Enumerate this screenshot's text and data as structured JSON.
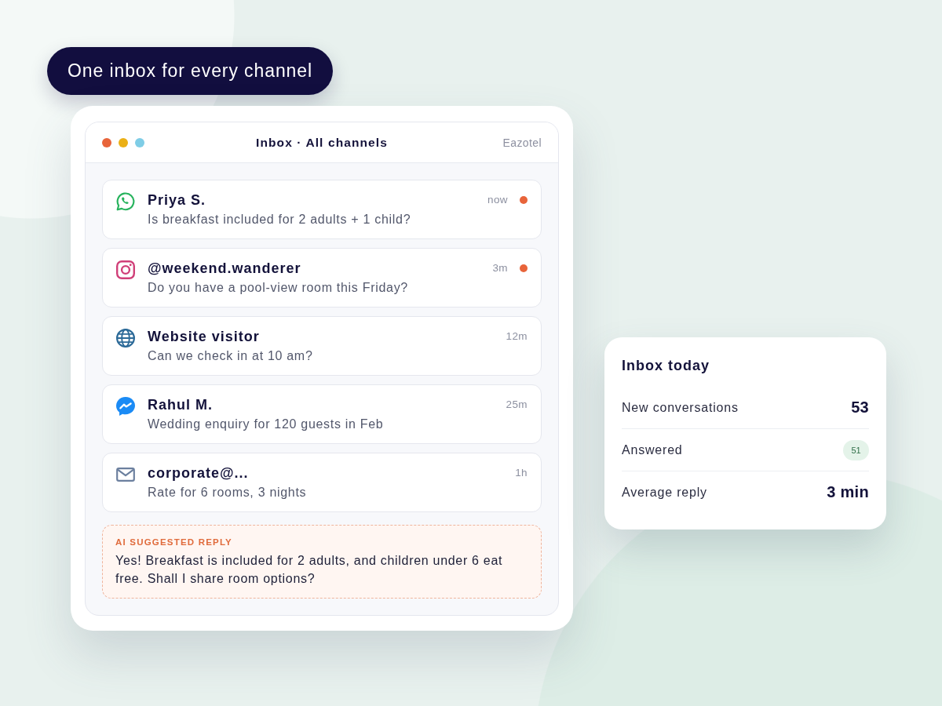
{
  "headline": "One inbox for every channel",
  "inbox_window": {
    "window_dots": [
      {
        "color": "#e8643a"
      },
      {
        "color": "#ebb016"
      },
      {
        "color": "#7fcde6"
      }
    ],
    "title": "Inbox · All channels",
    "brand": "Eazotel",
    "conversations": [
      {
        "kind": "whatsapp",
        "name": "Priya S.",
        "preview": "Is breakfast included for 2 adults + 1 child?",
        "time": "now",
        "unread": true
      },
      {
        "kind": "instagram",
        "name": "@weekend.wanderer",
        "preview": "Do you have a pool-view room this Friday?",
        "time": "3m",
        "unread": true
      },
      {
        "kind": "web",
        "name": "Website visitor",
        "preview": "Can we check in at 10 am?",
        "time": "12m",
        "unread": false
      },
      {
        "kind": "messenger",
        "name": "Rahul M.",
        "preview": "Wedding enquiry for 120 guests in Feb",
        "time": "25m",
        "unread": false
      },
      {
        "kind": "email",
        "name": "corporate@...",
        "preview": "Rate for 6 rooms, 3 nights",
        "time": "1h",
        "unread": false
      }
    ],
    "ai_suggestion": {
      "label": "AI SUGGESTED REPLY",
      "text": "Yes! Breakfast is included for 2 adults, and children under 6 eat free. Shall I share room options?"
    }
  },
  "stats_card": {
    "title": "Inbox today",
    "rows": [
      {
        "kind": "number",
        "label": "New conversations",
        "value": "53"
      },
      {
        "kind": "badge",
        "label": "Answered",
        "value": "51"
      },
      {
        "kind": "number",
        "label": "Average reply",
        "value": "3 min"
      }
    ]
  }
}
